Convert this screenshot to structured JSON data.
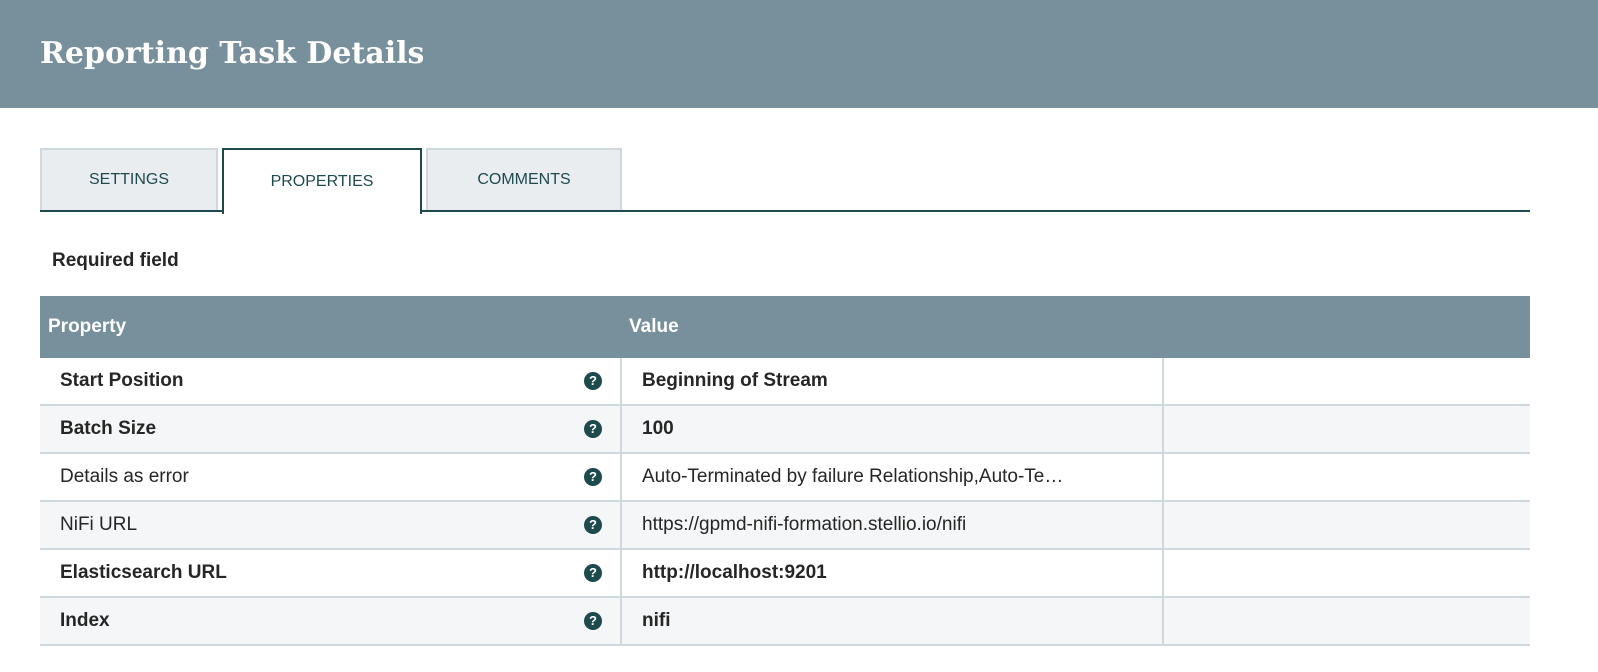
{
  "header": {
    "title": "Reporting Task Details"
  },
  "tabs": [
    {
      "label": "SETTINGS"
    },
    {
      "label": "PROPERTIES"
    },
    {
      "label": "COMMENTS"
    }
  ],
  "required_label": "Required field",
  "table": {
    "columns": [
      "Property",
      "Value"
    ],
    "rows": [
      {
        "property": "Start Position",
        "value": "Beginning of Stream",
        "required": true
      },
      {
        "property": "Batch Size",
        "value": "100",
        "required": true
      },
      {
        "property": "Details as error",
        "value": "Auto-Terminated by failure Relationship,Auto-Te…",
        "required": false
      },
      {
        "property": "NiFi URL",
        "value": "https://gpmd-nifi-formation.stellio.io/nifi",
        "required": false
      },
      {
        "property": "Elasticsearch URL",
        "value": "http://localhost:9201",
        "required": true
      },
      {
        "property": "Index",
        "value": "nifi",
        "required": true
      }
    ]
  },
  "help_glyph": "?"
}
